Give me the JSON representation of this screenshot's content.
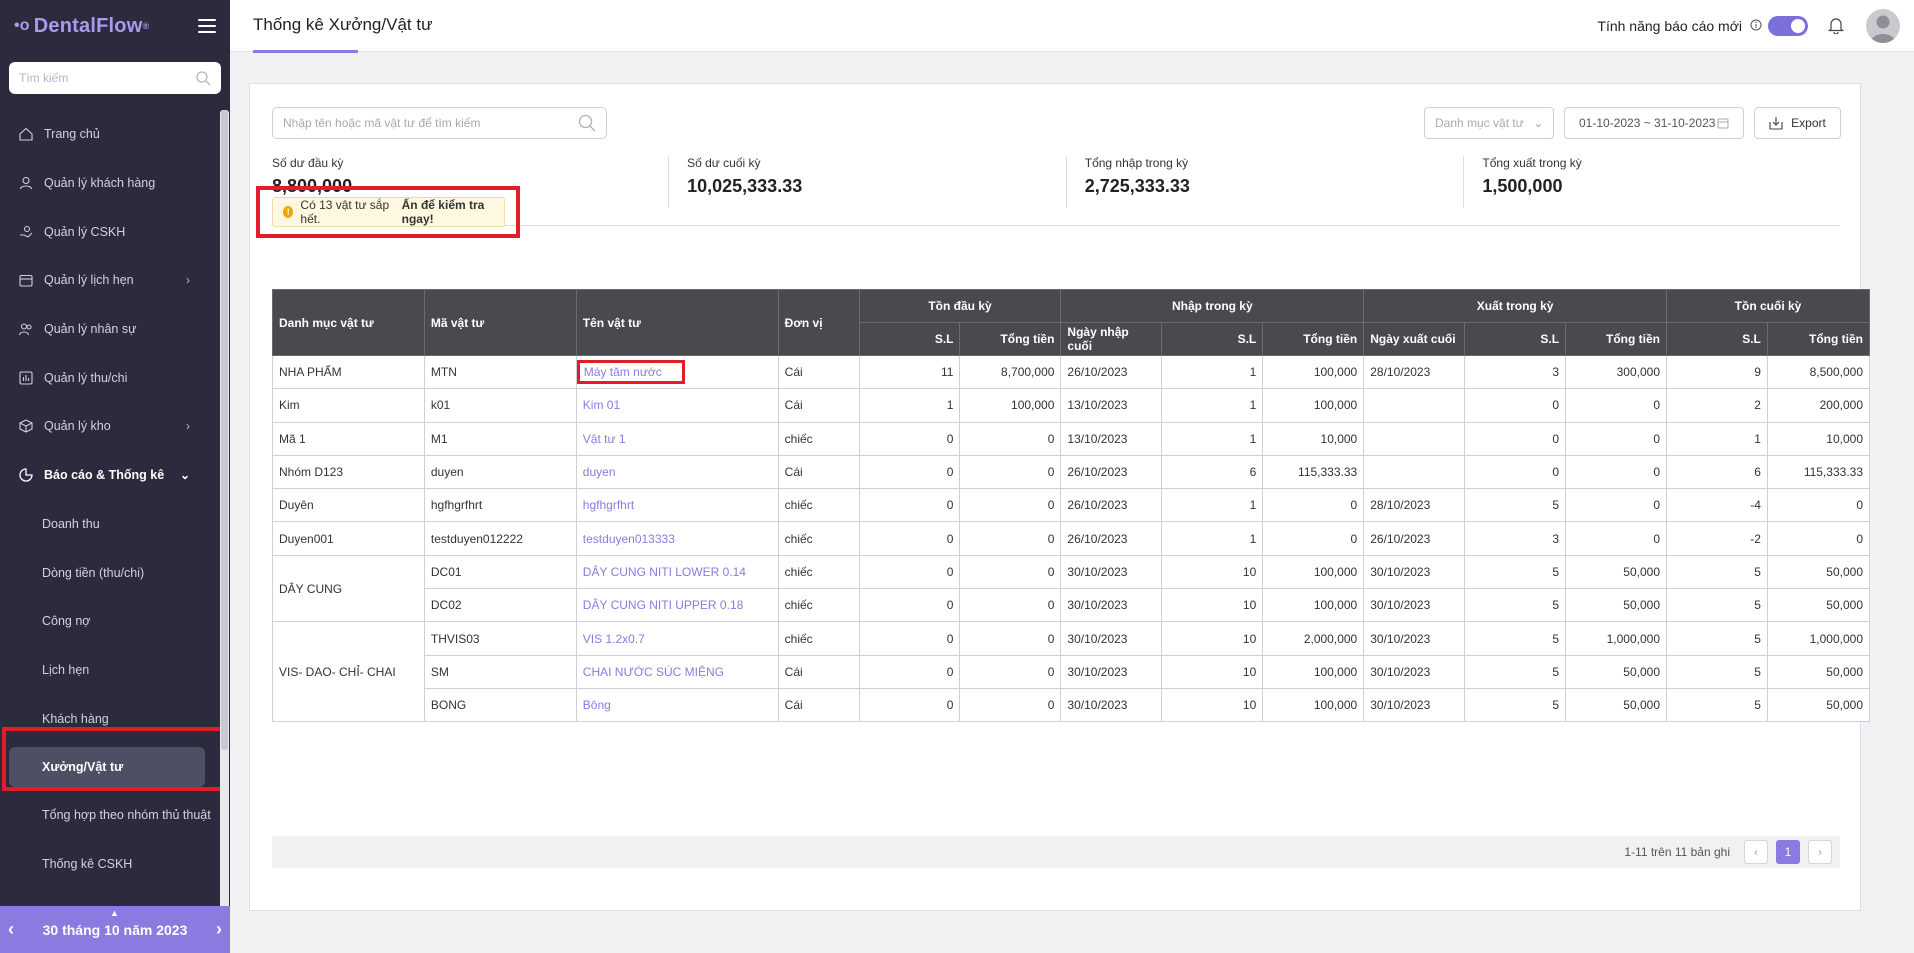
{
  "app": {
    "logo": "DentalFlow",
    "logo_mark": "•o",
    "reg": "®"
  },
  "sidebar": {
    "search_placeholder": "Tìm kiếm",
    "items": [
      {
        "label": "Trang chủ",
        "icon": "home-icon"
      },
      {
        "label": "Quản lý khách hàng",
        "icon": "user-icon"
      },
      {
        "label": "Quản lý CSKH",
        "icon": "care-icon"
      },
      {
        "label": "Quản lý lịch hẹn",
        "icon": "calendar-icon"
      },
      {
        "label": "Quản lý nhân sự",
        "icon": "staff-icon"
      },
      {
        "label": "Quản lý thu/chi",
        "icon": "finance-icon"
      },
      {
        "label": "Quản lý kho",
        "icon": "box-icon"
      },
      {
        "label": "Báo cáo & Thống kê",
        "icon": "chart-icon"
      }
    ],
    "sub_items": [
      "Doanh thu",
      "Dòng tiền (thu/chi)",
      "Công nợ",
      "Lịch hẹn",
      "Khách hàng",
      "Xưởng/Vật tư",
      "Tổng hợp theo nhóm thủ thuật",
      "Thống kê CSKH"
    ],
    "date_bar": "30 tháng 10 năm 2023"
  },
  "header": {
    "title": "Thống kê Xưởng/Vật tư",
    "feature_label": "Tính năng báo cáo mới"
  },
  "filters": {
    "search_placeholder": "Nhập tên hoặc mã vật tư để tìm kiếm",
    "category_placeholder": "Danh mục vật tư",
    "date_range": "01-10-2023 ~ 31-10-2023",
    "export_label": "Export"
  },
  "stats": [
    {
      "label": "Số dư đầu kỳ",
      "value": "8,800,000"
    },
    {
      "label": "Số dư cuối kỳ",
      "value": "10,025,333.33"
    },
    {
      "label": "Tổng nhập trong kỳ",
      "value": "2,725,333.33"
    },
    {
      "label": "Tổng xuất trong kỳ",
      "value": "1,500,000"
    }
  ],
  "alert": {
    "text": "Có 13 vật tư sắp hết.",
    "cta": "Ấn để kiểm tra ngay!"
  },
  "table": {
    "headers": {
      "category": "Danh mục vật tư",
      "code": "Mã vật tư",
      "name": "Tên vật tư",
      "unit": "Đơn vị",
      "opening": "Tồn đầu kỳ",
      "import": "Nhập trong kỳ",
      "export": "Xuất trong kỳ",
      "closing": "Tồn cuối kỳ",
      "qty": "S.L",
      "total": "Tổng tiền",
      "last_import": "Ngày nhập cuối",
      "last_export": "Ngày xuất cuối"
    },
    "rows": [
      {
        "category": "NHA PHẨM",
        "code": "MTN",
        "name": "Máy tăm nước",
        "unit": "Cái",
        "o_qty": "11",
        "o_total": "8,700,000",
        "i_date": "26/10/2023",
        "i_qty": "1",
        "i_total": "100,000",
        "e_date": "28/10/2023",
        "e_qty": "3",
        "e_total": "300,000",
        "c_qty": "9",
        "c_total": "8,500,000"
      },
      {
        "category": "Kim",
        "code": "k01",
        "name": "Kim 01",
        "unit": "Cái",
        "o_qty": "1",
        "o_total": "100,000",
        "i_date": "13/10/2023",
        "i_qty": "1",
        "i_total": "100,000",
        "e_date": "",
        "e_qty": "0",
        "e_total": "0",
        "c_qty": "2",
        "c_total": "200,000"
      },
      {
        "category": "Mã 1",
        "code": "M1",
        "name": "Vật tư 1",
        "unit": "chiếc",
        "o_qty": "0",
        "o_total": "0",
        "i_date": "13/10/2023",
        "i_qty": "1",
        "i_total": "10,000",
        "e_date": "",
        "e_qty": "0",
        "e_total": "0",
        "c_qty": "1",
        "c_total": "10,000"
      },
      {
        "category": "Nhóm D123",
        "code": "duyen",
        "name": "duyen",
        "unit": "Cái",
        "o_qty": "0",
        "o_total": "0",
        "i_date": "26/10/2023",
        "i_qty": "6",
        "i_total": "115,333.33",
        "e_date": "",
        "e_qty": "0",
        "e_total": "0",
        "c_qty": "6",
        "c_total": "115,333.33"
      },
      {
        "category": "Duyên",
        "code": "hgfhgrfhrt",
        "name": "hgfhgrfhrt",
        "unit": "chiếc",
        "o_qty": "0",
        "o_total": "0",
        "i_date": "26/10/2023",
        "i_qty": "1",
        "i_total": "0",
        "e_date": "28/10/2023",
        "e_qty": "5",
        "e_total": "0",
        "c_qty": "-4",
        "c_total": "0"
      },
      {
        "category": "Duyen001",
        "code": "testduyen012222",
        "name": "testduyen013333",
        "unit": "chiếc",
        "o_qty": "0",
        "o_total": "0",
        "i_date": "26/10/2023",
        "i_qty": "1",
        "i_total": "0",
        "e_date": "26/10/2023",
        "e_qty": "3",
        "e_total": "0",
        "c_qty": "-2",
        "c_total": "0"
      },
      {
        "category": "DÂY CUNG",
        "code": "DC01",
        "name": "DÂY CUNG NITI LOWER 0.14",
        "unit": "chiếc",
        "o_qty": "0",
        "o_total": "0",
        "i_date": "30/10/2023",
        "i_qty": "10",
        "i_total": "100,000",
        "e_date": "30/10/2023",
        "e_qty": "5",
        "e_total": "50,000",
        "c_qty": "5",
        "c_total": "50,000"
      },
      {
        "category": "",
        "code": "DC02",
        "name": "DÂY CUNG NITI UPPER 0.18",
        "unit": "chiếc",
        "o_qty": "0",
        "o_total": "0",
        "i_date": "30/10/2023",
        "i_qty": "10",
        "i_total": "100,000",
        "e_date": "30/10/2023",
        "e_qty": "5",
        "e_total": "50,000",
        "c_qty": "5",
        "c_total": "50,000"
      },
      {
        "category": "VIS- DAO- CHỈ- CHAI",
        "code": "THVIS03",
        "name": "VIS 1.2x0.7",
        "unit": "chiếc",
        "o_qty": "0",
        "o_total": "0",
        "i_date": "30/10/2023",
        "i_qty": "10",
        "i_total": "2,000,000",
        "e_date": "30/10/2023",
        "e_qty": "5",
        "e_total": "1,000,000",
        "c_qty": "5",
        "c_total": "1,000,000"
      },
      {
        "category": "",
        "code": "SM",
        "name": "CHAI NƯỚC SÚC MIỆNG",
        "unit": "Cái",
        "o_qty": "0",
        "o_total": "0",
        "i_date": "30/10/2023",
        "i_qty": "10",
        "i_total": "100,000",
        "e_date": "30/10/2023",
        "e_qty": "5",
        "e_total": "50,000",
        "c_qty": "5",
        "c_total": "50,000"
      },
      {
        "category": "",
        "code": "BONG",
        "name": "Bông",
        "unit": "Cái",
        "o_qty": "0",
        "o_total": "0",
        "i_date": "30/10/2023",
        "i_qty": "10",
        "i_total": "100,000",
        "e_date": "30/10/2023",
        "e_qty": "5",
        "e_total": "50,000",
        "c_qty": "5",
        "c_total": "50,000"
      }
    ]
  },
  "pagination": {
    "info": "1-11 trên 11 bản ghi",
    "current": "1",
    "prev": "‹",
    "next": "›"
  }
}
